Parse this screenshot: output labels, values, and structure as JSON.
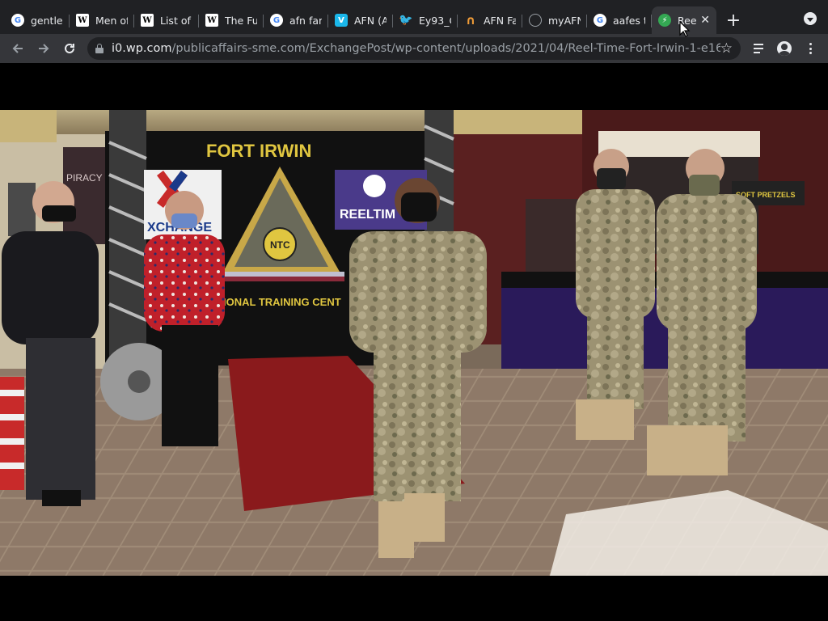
{
  "browser": {
    "tabs": [
      {
        "icon": "google-icon",
        "title": "gentlem"
      },
      {
        "icon": "wikipedia-icon",
        "title": "Men of"
      },
      {
        "icon": "wikipedia-icon",
        "title": "List of"
      },
      {
        "icon": "wikipedia-icon",
        "title": "The Fu"
      },
      {
        "icon": "google-icon",
        "title": "afn fam"
      },
      {
        "icon": "vimeo-icon",
        "title": "AFN (A"
      },
      {
        "icon": "twitter-icon",
        "title": "Ey93_C"
      },
      {
        "icon": "afn-icon",
        "title": "AFN Fa"
      },
      {
        "icon": "globe-icon",
        "title": "myAFN"
      },
      {
        "icon": "google-icon",
        "title": "aafes t"
      },
      {
        "icon": "green-leaf-icon",
        "title": "Ree",
        "active": true
      }
    ],
    "close_glyph": "✕",
    "new_tab_glyph": "+"
  },
  "toolbar": {
    "url_host": "i0.wp.com",
    "url_path": "/publicaffairs-sme.com/ExchangePost/wp-content/uploads/2021/04/Reel-Time-Fort-Irwin-1-e161738..."
  },
  "photo": {
    "banner_title": "FORT IRWIN",
    "banner_bottom": "IONAL TRAINING CENT",
    "exchange_logo": "XCHANGE",
    "reeltime_logo": "REELTIM",
    "ntc_badge": "NTC",
    "piracy_sign": "PIRACY",
    "pretzel_sign": "SOFT PRETZELS"
  }
}
